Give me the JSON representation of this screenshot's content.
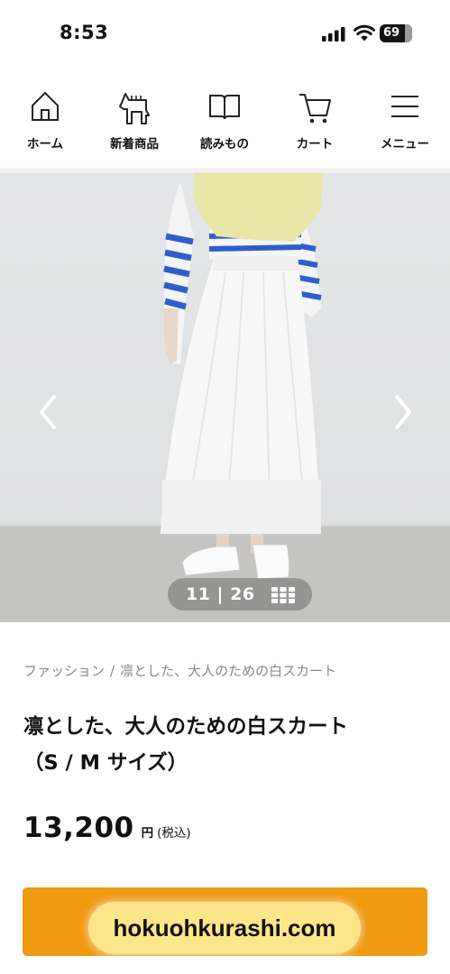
{
  "status_bar": {
    "time": "8:53",
    "battery": "69"
  },
  "nav": {
    "items": [
      {
        "label": "ホーム",
        "icon": "home-icon"
      },
      {
        "label": "新着商品",
        "icon": "horse-icon"
      },
      {
        "label": "読みもの",
        "icon": "book-icon"
      },
      {
        "label": "カート",
        "icon": "cart-icon"
      },
      {
        "label": "メニュー",
        "icon": "menu-icon"
      }
    ]
  },
  "gallery": {
    "counter": "11 | 26",
    "current": 11,
    "total": 26
  },
  "breadcrumb": {
    "category": "ファッション",
    "separator": "/",
    "current": "凛とした、大人のための白スカート"
  },
  "product": {
    "title_line1": "凛とした、大人のための白スカート",
    "title_line2": "（S / M サイズ）",
    "price": "13,200",
    "price_unit": "円",
    "tax_note": "(税込)"
  },
  "watermark": {
    "text": "hokuohkurashi.com"
  },
  "colors": {
    "cart_button": "#f09a11",
    "watermark_bg": "#fde68a"
  }
}
